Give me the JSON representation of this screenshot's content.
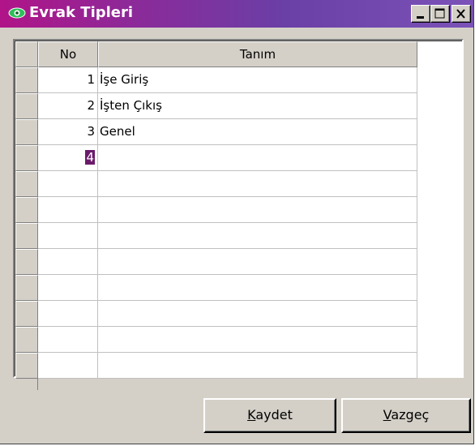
{
  "window": {
    "title": "Evrak Tipleri",
    "icon": "eye-icon",
    "controls": [
      "minimize-icon",
      "maximize-icon",
      "close-icon"
    ]
  },
  "grid": {
    "columns": [
      "No",
      "Tanım"
    ],
    "rows": [
      {
        "no": "1",
        "tanim": "İşe Giriş"
      },
      {
        "no": "2",
        "tanim": "İşten Çıkış"
      },
      {
        "no": "3",
        "tanim": "Genel"
      },
      {
        "no": "4",
        "tanim": "",
        "editing": true
      },
      {
        "no": "",
        "tanim": ""
      },
      {
        "no": "",
        "tanim": ""
      },
      {
        "no": "",
        "tanim": ""
      },
      {
        "no": "",
        "tanim": ""
      },
      {
        "no": "",
        "tanim": ""
      },
      {
        "no": "",
        "tanim": ""
      },
      {
        "no": "",
        "tanim": ""
      },
      {
        "no": "",
        "tanim": ""
      }
    ]
  },
  "buttons": {
    "save": {
      "accel": "K",
      "rest": "aydet"
    },
    "cancel": {
      "accel": "V",
      "rest": "azgeç"
    }
  },
  "colors": {
    "title_start": "#b01488",
    "title_end": "#7b52b8",
    "selection": "#6b1a6b",
    "face": "#d4d0c8"
  }
}
